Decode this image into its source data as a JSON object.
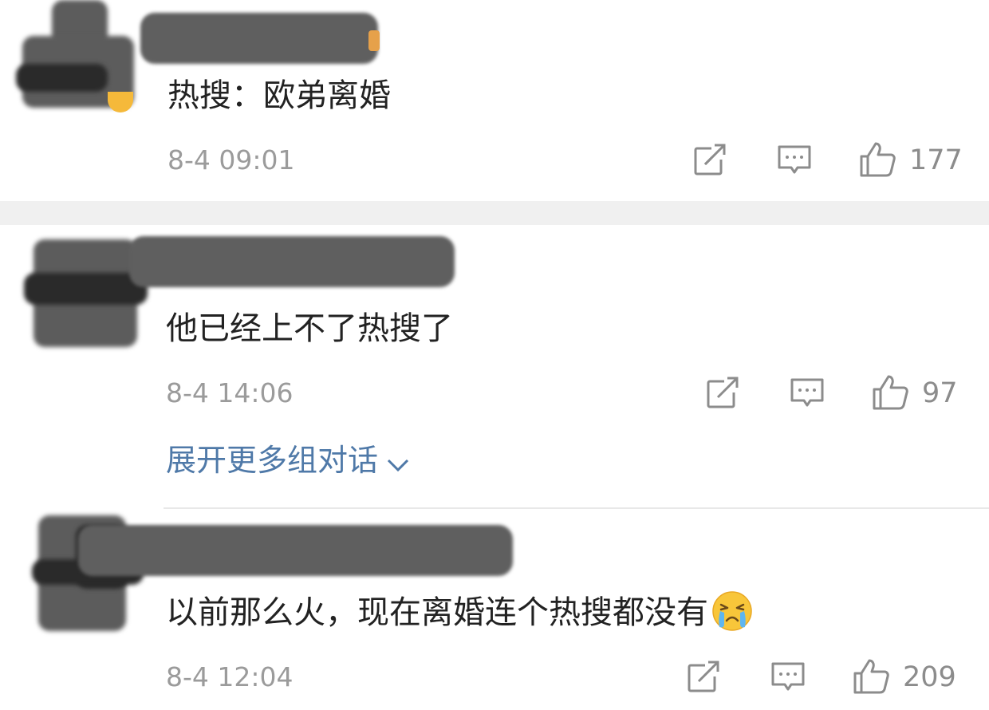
{
  "comments": [
    {
      "text": "热搜：欧弟离婚",
      "time": "8-4 09:01",
      "likes": "177"
    },
    {
      "text": "他已经上不了热搜了",
      "time": "8-4 14:06",
      "likes": "97"
    },
    {
      "text": "以前那么火，现在离婚连个热搜都没有",
      "time": "8-4 12:04",
      "likes": "209",
      "emoji": "crying-face"
    }
  ],
  "expand_thread_label": "展开更多组对话",
  "colors": {
    "link": "#4f79a8",
    "text": "#222222",
    "meta": "#9b9b9b",
    "divider": "#f0f0f0"
  },
  "icons": [
    "share-icon",
    "comment-icon",
    "thumbs-up-icon",
    "chevron-down-icon"
  ]
}
